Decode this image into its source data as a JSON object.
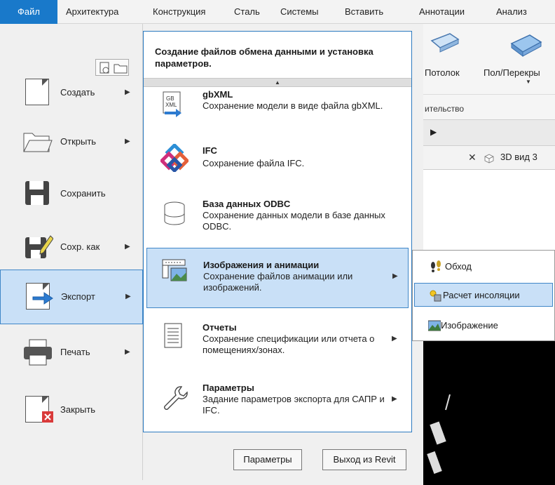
{
  "ribbon": {
    "tabs": [
      "Файл",
      "Архитектура",
      "Конструкция",
      "Сталь",
      "Системы",
      "Вставить",
      "Аннотации",
      "Анализ"
    ],
    "buttons": [
      "Потолок",
      "Пол/Перекры"
    ],
    "group_label": "ительство",
    "view_tab": "3D вид 3",
    "view_tab_close": "✕"
  },
  "left_menu": {
    "items": [
      {
        "label": "Создать",
        "icon": "new-document-icon",
        "has_arrow": true
      },
      {
        "label": "Открыть",
        "icon": "open-folder-icon",
        "has_arrow": true
      },
      {
        "label": "Сохранить",
        "icon": "save-icon",
        "has_arrow": false
      },
      {
        "label": "Сохр. как",
        "icon": "save-as-icon",
        "has_arrow": true
      },
      {
        "label": "Экспорт",
        "icon": "export-icon",
        "has_arrow": true,
        "active": true
      },
      {
        "label": "Печать",
        "icon": "printer-icon",
        "has_arrow": true
      },
      {
        "label": "Закрыть",
        "icon": "close-document-icon",
        "has_arrow": false
      }
    ],
    "arrow": "▶"
  },
  "export_panel": {
    "title": "Создание файлов обмена данными и установка параметров.",
    "scroll_up": "▲",
    "items": [
      {
        "title": "gbXML",
        "desc": "Сохранение модели в виде файла gbXML.",
        "icon": "gbxml-icon",
        "has_arrow": false
      },
      {
        "title": "IFC",
        "desc": "Сохранение файла IFC.",
        "icon": "ifc-icon",
        "has_arrow": false
      },
      {
        "title": "База данных ODBC",
        "desc": "Сохранение данных модели в базе данных ODBC.",
        "icon": "database-icon",
        "has_arrow": false
      },
      {
        "title": "Изображения и анимации",
        "desc": "Сохранение файлов анимации или изображений.",
        "icon": "images-animation-icon",
        "has_arrow": true,
        "active": true
      },
      {
        "title": "Отчеты",
        "desc": "Сохранение спецификации или отчета о помещениях/зонах.",
        "icon": "report-icon",
        "has_arrow": true
      },
      {
        "title": "Параметры",
        "desc": "Задание параметров экспорта для САПР и IFC.",
        "icon": "wrench-icon",
        "has_arrow": true
      }
    ]
  },
  "bottom_buttons": {
    "options": "Параметры",
    "exit": "Выход из Revit"
  },
  "submenu": {
    "items": [
      {
        "label": "Обход",
        "icon": "walkthrough-icon"
      },
      {
        "label": "Расчет инсоляции",
        "icon": "solar-study-icon",
        "active": true
      },
      {
        "label": "Изображение",
        "icon": "image-icon"
      }
    ]
  },
  "colors": {
    "file_tab": "#1979ca",
    "highlight_bg": "#c9e0f7",
    "highlight_border": "#3f86c7",
    "panel_border": "#2b7ac0"
  }
}
